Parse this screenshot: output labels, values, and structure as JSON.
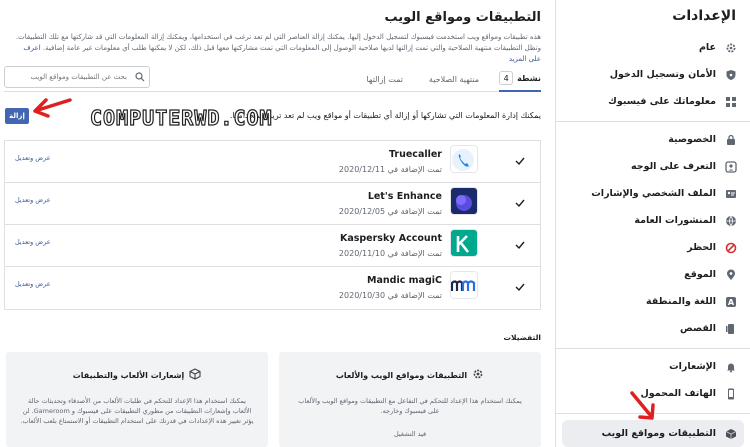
{
  "sidebar": {
    "title": "الإعدادات",
    "groups": [
      [
        {
          "label": "عام",
          "icon": "gear-icon"
        },
        {
          "label": "الأمان وتسجيل الدخول",
          "icon": "shield-icon"
        },
        {
          "label": "معلوماتك على فيسبوك",
          "icon": "info-grid-icon"
        }
      ],
      [
        {
          "label": "الخصوصية",
          "icon": "lock-icon"
        },
        {
          "label": "التعرف على الوجه",
          "icon": "face-icon"
        },
        {
          "label": "الملف الشخصي والإشارات",
          "icon": "profile-tag-icon"
        },
        {
          "label": "المنشورات العامة",
          "icon": "globe-icon"
        },
        {
          "label": "الحظر",
          "icon": "block-icon"
        },
        {
          "label": "الموقع",
          "icon": "location-pin-icon"
        },
        {
          "label": "اللغة والمنطقة",
          "icon": "language-icon"
        },
        {
          "label": "القصص",
          "icon": "stories-icon"
        }
      ],
      [
        {
          "label": "الإشعارات",
          "icon": "bell-icon"
        },
        {
          "label": "الهاتف المحمول",
          "icon": "phone-icon"
        }
      ],
      [
        {
          "label": "التطبيقات ومواقع الويب",
          "icon": "cube-icon",
          "active": true
        }
      ]
    ]
  },
  "main": {
    "title": "التطبيقات ومواقع الويب",
    "description": "هذه تطبيقات ومواقع ويب استخدمت فيسبوك لتسجيل الدخول إليها. يمكنك إزالة العناصر التي لم تعد ترغب في استخدامها، ويمكنك إزالة المعلومات التي قد شاركتها مع تلك التطبيقات. وتظل التطبيقات منتهية الصلاحية والتي تمت إزالتها لديها صلاحية الوصول إلى المعلومات التي تمت مشاركتها معها قبل ذلك، لكن لا يمكنها طلب أي معلومات غير عامة إضافية.",
    "learn_more": "اعرف على المزيد",
    "tabs": [
      {
        "label": "نشطة",
        "count": "4"
      },
      {
        "label": "منتهية الصلاحية"
      },
      {
        "label": "تمت إزالتها"
      }
    ],
    "search_placeholder": "بحث عن التطبيقات ومواقع الويب",
    "info_text": "يمكنك إدارة المعلومات التي تشاركها أو إزالة أي تطبيقات أو مواقع ويب لم تعد تريد استخدامها.",
    "remove_label": "إزالة",
    "watermark": "COMPUTERWD.COM",
    "apps": [
      {
        "name": "Truecaller",
        "date": "تمت الإضافة في 2020/12/11",
        "action": "عرض وتعديل",
        "logo": "truecaller"
      },
      {
        "name": "Let's Enhance",
        "date": "تمت الإضافة في 2020/12/05",
        "action": "عرض وتعديل",
        "logo": "letsenhance"
      },
      {
        "name": "Kaspersky Account",
        "date": "تمت الإضافة في 2020/11/10",
        "action": "عرض وتعديل",
        "logo": "kaspersky"
      },
      {
        "name": "Mandic magiC",
        "date": "تمت الإضافة في 2020/10/30",
        "action": "عرض وتعديل",
        "logo": "mandic"
      }
    ],
    "prefs_title": "التفضيلات",
    "pref_cards": [
      {
        "title": "التطبيقات ومواقع الويب والألعاب",
        "desc": "يمكنك استخدام هذا الإعداد للتحكم في التفاعل مع التطبيقات ومواقع الويب والألعاب على فيسبوك وخارجه.",
        "status": "قيد التشغيل",
        "icon": "gear-icon"
      },
      {
        "title": "إشعارات الألعاب والتطبيقات",
        "desc": "يمكنك استخدام هذا الإعداد للتحكم في طلبات الألعاب من الأصدقاء وتحديثات حالة الألعاب وإشعارات التطبيقات من مطوري التطبيقات على فيسبوك و Gameroom. لن يؤثر تغيير هذه الإعدادات في قدرتك على استخدام التطبيقات أو الاستمتاع بلعب الألعاب.",
        "status": "",
        "icon": "cube-icon"
      }
    ]
  },
  "colors": {
    "accent": "#4267b2",
    "link": "#385898",
    "arrow": "#e02020"
  }
}
